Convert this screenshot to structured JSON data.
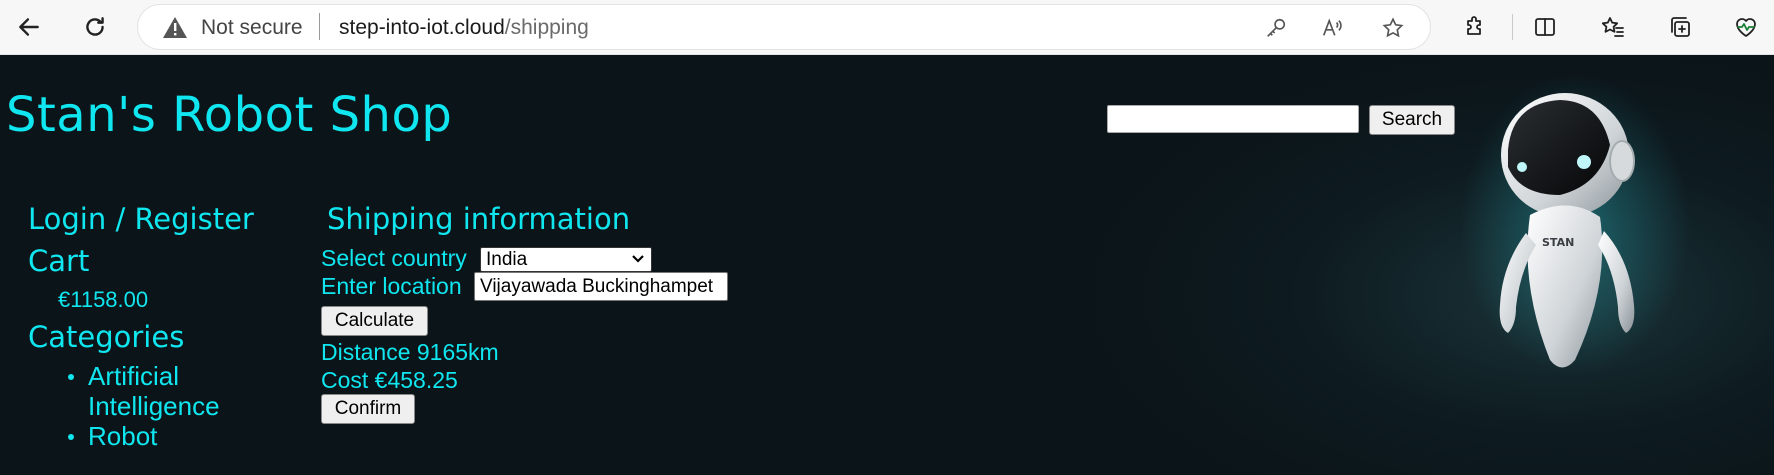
{
  "browser": {
    "security_label": "Not secure",
    "url_host": "step-into-iot.cloud",
    "url_path": "/shipping"
  },
  "page": {
    "title": "Stan's Robot Shop",
    "search_button": "Search",
    "search_value": "",
    "nav": {
      "login": "Login / Register",
      "cart": "Cart",
      "cart_total": "€1158.00",
      "categories": "Categories",
      "category_items": [
        "Artificial Intelligence",
        "Robot"
      ]
    },
    "shipping": {
      "heading": "Shipping information",
      "country_label": "Select country",
      "country_value": "India",
      "location_label": "Enter location",
      "location_value": "Vijayawada Buckinghampet",
      "calculate_button": "Calculate",
      "distance": "Distance 9165km",
      "cost": "Cost €458.25",
      "confirm_button": "Confirm"
    },
    "mascot_label": "STAN"
  },
  "colors": {
    "accent": "#10e6ef",
    "background": "#0d1418"
  }
}
